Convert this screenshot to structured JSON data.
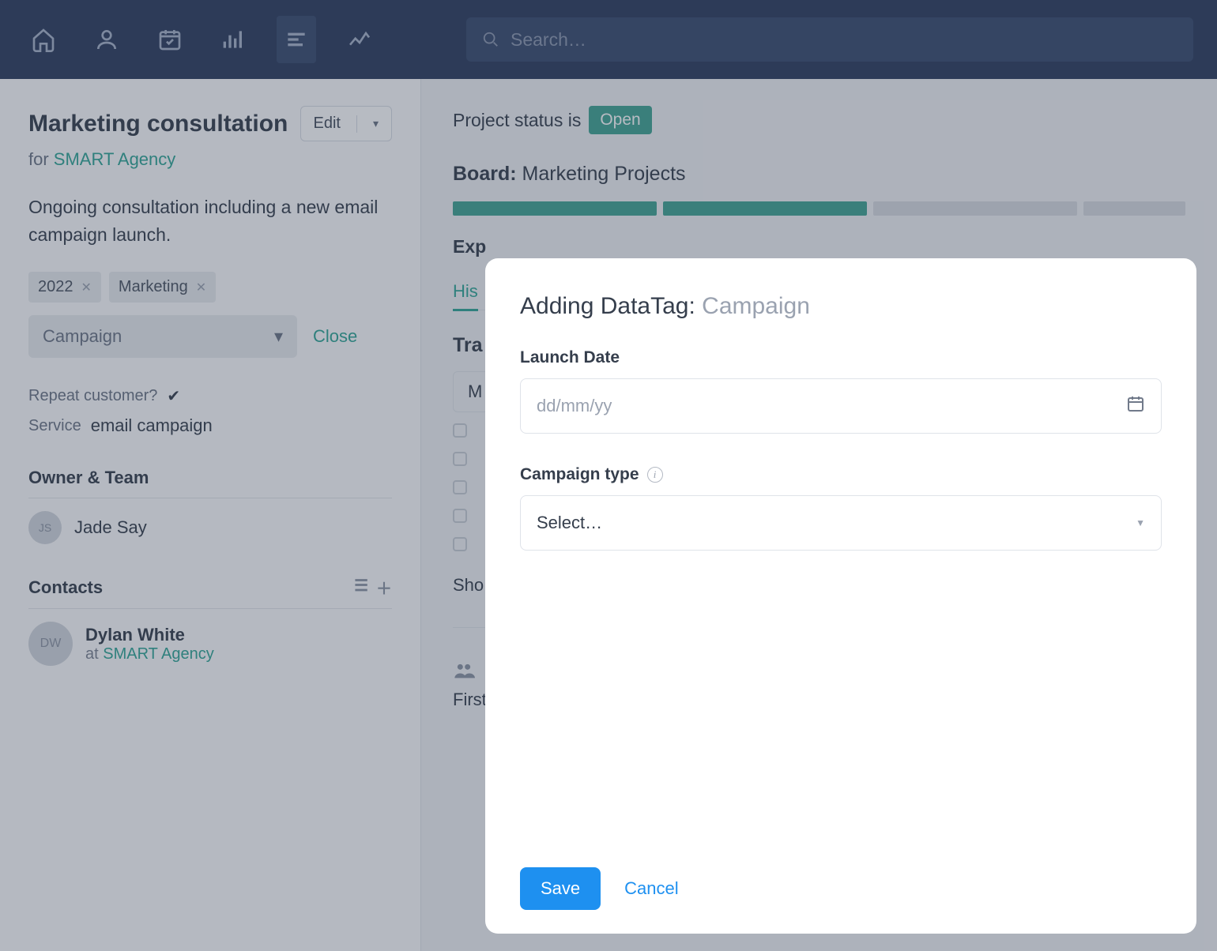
{
  "search": {
    "placeholder": "Search…"
  },
  "sidebar": {
    "title": "Marketing consultation",
    "edit_label": "Edit",
    "for_prefix": "for ",
    "for_link": "SMART Agency",
    "description": "Ongoing consultation including a new email campaign launch.",
    "tags": [
      "2022",
      "Marketing"
    ],
    "select_value": "Campaign",
    "close_label": "Close",
    "repeat_label": "Repeat customer?",
    "service_label": "Service",
    "service_value": "email campaign",
    "owner_section": "Owner & Team",
    "owner": {
      "initials": "JS",
      "name": "Jade Say"
    },
    "contacts_section": "Contacts",
    "contact": {
      "initials": "DW",
      "name": "Dylan White",
      "at_prefix": "at ",
      "org": "SMART Agency"
    }
  },
  "main": {
    "status_prefix": "Project status is",
    "status_value": "Open",
    "board_label": "Board:",
    "board_value": "Marketing Projects",
    "expected_label": "Exp",
    "tab_his": "His",
    "track_head": "Tra",
    "track_box": "M",
    "show_label": "Sho",
    "cutoff_text": "First meeting to discuss potential consultancy went well, now need to gather a pla"
  },
  "modal": {
    "title_prefix": "Adding DataTag: ",
    "title_value": "Campaign",
    "field_launch": "Launch Date",
    "placeholder_date": "dd/mm/yy",
    "field_type": "Campaign type",
    "select_placeholder": "Select…",
    "save_label": "Save",
    "cancel_label": "Cancel"
  }
}
